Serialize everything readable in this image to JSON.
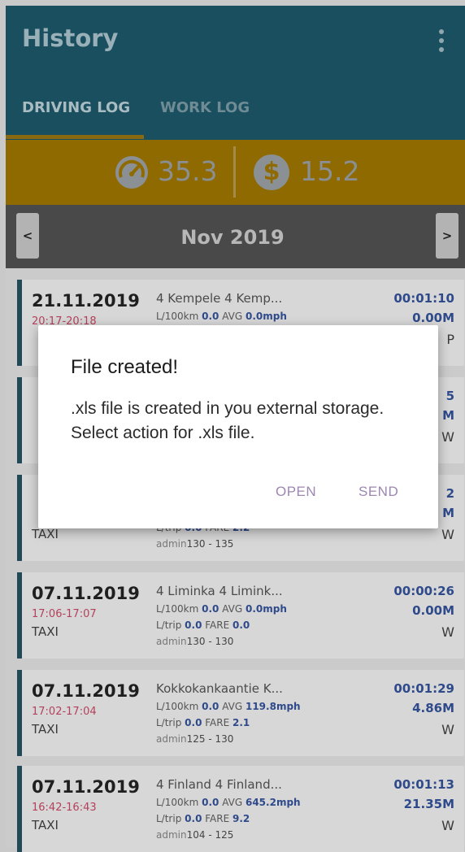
{
  "header": {
    "title": "History"
  },
  "tabs": [
    {
      "label": "DRIVING LOG"
    },
    {
      "label": "WORK LOG"
    }
  ],
  "stats": {
    "consumption": "35.3",
    "money": "15.2"
  },
  "month_nav": {
    "prev_label": "<",
    "next_label": ">",
    "month": "Nov 2019"
  },
  "entries": [
    {
      "date": "21.11.2019",
      "time": "20:17-20:18",
      "type": "",
      "route": "4 Kempele 4 Kemp...",
      "l100_label": "L/100km",
      "l100": "0.0",
      "avg_label": "AVG",
      "avg": "0.0mph",
      "ltrip_label": "",
      "ltrip": "",
      "fare_label": "",
      "fare": "",
      "user": "",
      "km": "",
      "duration": "00:01:10",
      "distance": "0.00M",
      "code": "P"
    },
    {
      "date": "",
      "time": "",
      "type": "",
      "route": "",
      "l100_label": "",
      "l100": "",
      "avg_label": "",
      "avg": "",
      "ltrip_label": "",
      "ltrip": "",
      "fare_label": "",
      "fare": "",
      "user": "",
      "km": "",
      "duration": "5",
      "distance": "M",
      "code": "W"
    },
    {
      "date": "",
      "time": "",
      "type": "TAXI",
      "route": "",
      "l100_label": "",
      "l100": "",
      "avg_label": "",
      "avg": "",
      "ltrip_label": "L/trip",
      "ltrip": "0.0",
      "fare_label": "FARE",
      "fare": "2.2",
      "user": "admin",
      "km": "130 - 135",
      "duration": "2",
      "distance": "M",
      "code": "W"
    },
    {
      "date": "07.11.2019",
      "time": "17:06-17:07",
      "type": "TAXI",
      "route": "4 Liminka 4 Limink...",
      "l100_label": "L/100km",
      "l100": "0.0",
      "avg_label": "AVG",
      "avg": "0.0mph",
      "ltrip_label": "L/trip",
      "ltrip": "0.0",
      "fare_label": "FARE",
      "fare": "0.0",
      "user": "admin",
      "km": "130 - 130",
      "duration": "00:00:26",
      "distance": "0.00M",
      "code": "W"
    },
    {
      "date": "07.11.2019",
      "time": "17:02-17:04",
      "type": "TAXI",
      "route": "Kokkokankaantie K...",
      "l100_label": "L/100km",
      "l100": "0.0",
      "avg_label": "AVG",
      "avg": "119.8mph",
      "ltrip_label": "L/trip",
      "ltrip": "0.0",
      "fare_label": "FARE",
      "fare": "2.1",
      "user": "admin",
      "km": "125 - 130",
      "duration": "00:01:29",
      "distance": "4.86M",
      "code": "W"
    },
    {
      "date": "07.11.2019",
      "time": "16:42-16:43",
      "type": "TAXI",
      "route": "4 Finland 4 Finland...",
      "l100_label": "L/100km",
      "l100": "0.0",
      "avg_label": "AVG",
      "avg": "645.2mph",
      "ltrip_label": "L/trip",
      "ltrip": "0.0",
      "fare_label": "FARE",
      "fare": "9.2",
      "user": "admin",
      "km": "104 - 125",
      "duration": "00:01:13",
      "distance": "21.35M",
      "code": "W"
    }
  ],
  "dialog": {
    "title": "File created!",
    "message": ".xls file is created in you external storage. Select action for .xls file.",
    "open_label": "OPEN",
    "send_label": "SEND"
  }
}
